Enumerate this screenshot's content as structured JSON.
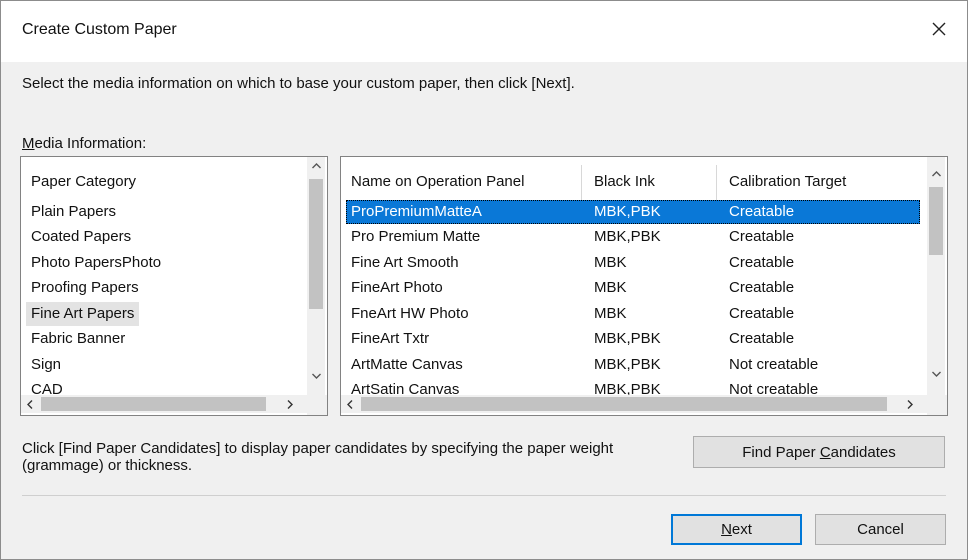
{
  "dialog": {
    "title": "Create Custom Paper",
    "close_glyph": "✕",
    "instruction": "Select the media information on which to base your custom paper, then click [Next].",
    "media_label_mnemonic": "M",
    "media_label_rest": "edia Information:"
  },
  "category_list": {
    "header": "Paper Category",
    "items": [
      {
        "label": "Plain Papers"
      },
      {
        "label": "Coated Papers"
      },
      {
        "label": "Photo PapersPhoto"
      },
      {
        "label": "Proofing Papers"
      },
      {
        "label": "Fine Art Papers",
        "selected": true
      },
      {
        "label": "Fabric Banner"
      },
      {
        "label": "Sign"
      },
      {
        "label": "CAD"
      }
    ]
  },
  "media_list": {
    "columns": [
      "Name on Operation Panel",
      "Black Ink",
      "Calibration Target"
    ],
    "rows": [
      {
        "name": "ProPremiumMatteA",
        "ink": "MBK,PBK",
        "calibration": "Creatable",
        "selected": true
      },
      {
        "name": "Pro Premium Matte",
        "ink": "MBK,PBK",
        "calibration": "Creatable"
      },
      {
        "name": "Fine Art Smooth",
        "ink": "MBK",
        "calibration": "Creatable"
      },
      {
        "name": "FineArt Photo",
        "ink": "MBK",
        "calibration": "Creatable"
      },
      {
        "name": "FneArt HW Photo",
        "ink": "MBK",
        "calibration": "Creatable"
      },
      {
        "name": "FineArt Txtr",
        "ink": "MBK,PBK",
        "calibration": "Creatable"
      },
      {
        "name": "ArtMatte Canvas",
        "ink": "MBK,PBK",
        "calibration": "Not creatable"
      },
      {
        "name": "ArtSatin Canvas",
        "ink": "MBK,PBK",
        "calibration": "Not creatable"
      }
    ]
  },
  "find": {
    "hint": "Click [Find Paper Candidates] to display paper candidates by specifying the paper weight (grammage) or thickness.",
    "button_before": "Find Paper ",
    "button_mnemonic": "C",
    "button_after": "andidates"
  },
  "buttons": {
    "next_mnemonic": "N",
    "next_rest": "ext",
    "cancel": "Cancel"
  },
  "colors": {
    "selection": "#0a78d7",
    "default_button_border": "#0078d7",
    "dialog_background": "#f0f0f0"
  },
  "icons": [
    "close-icon",
    "scroll-up-icon",
    "scroll-down-icon",
    "scroll-left-icon",
    "scroll-right-icon"
  ]
}
